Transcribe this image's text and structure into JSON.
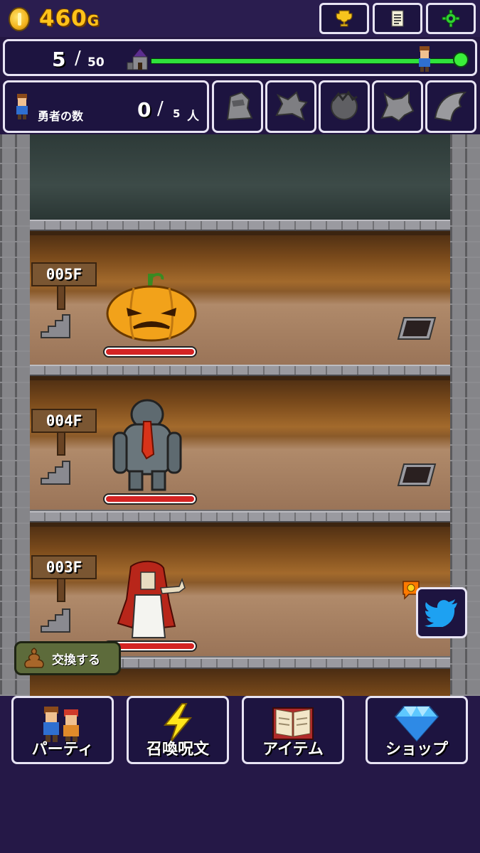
{
  "header": {
    "gold": {
      "amount": "460",
      "unit": "G"
    },
    "buttons": [
      {
        "icon": "trophy-icon"
      },
      {
        "icon": "document-icon"
      },
      {
        "icon": "gear-icon"
      }
    ]
  },
  "progress": {
    "current_floor": "5",
    "separator": "/",
    "max_floor": "50",
    "ratio": 0.97
  },
  "heroes": {
    "label": "勇者の数",
    "count": "0",
    "separator": "/",
    "max": "5",
    "unit": "人"
  },
  "monster_slots": [
    "knight-silhouette-icon",
    "dragon-silhouette-icon",
    "beast-silhouette-icon",
    "wolf-silhouette-icon",
    "ghost-silhouette-icon"
  ],
  "floors": [
    {
      "label": "005F",
      "monster": "pumpkin-monster"
    },
    {
      "label": "004F",
      "monster": "gray-zombie-monster"
    },
    {
      "label": "003F",
      "monster": "red-hair-ghost-monster"
    }
  ],
  "exchange_button": {
    "label": "交換する"
  },
  "nav": [
    {
      "label": "パーティ",
      "icon": "party-icon"
    },
    {
      "label": "召喚呪文",
      "icon": "lightning-icon"
    },
    {
      "label": "アイテム",
      "icon": "book-icon"
    },
    {
      "label": "ショップ",
      "icon": "diamond-icon"
    }
  ],
  "colors": {
    "background": "#241743",
    "panel": "#1d1440",
    "gold": "#ffc21a",
    "progress": "#2fe23c",
    "hp": "#d42323"
  }
}
